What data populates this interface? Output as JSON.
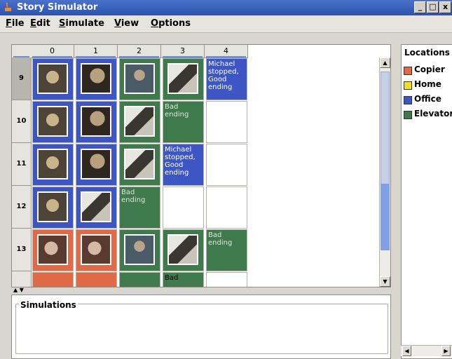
{
  "app": {
    "title": "Story Simulator"
  },
  "window_buttons": {
    "minimize": "_",
    "maximize": "□",
    "close": "x"
  },
  "menu": [
    "File",
    "Edit",
    "Simulate",
    "View",
    "Options"
  ],
  "grid": {
    "columns": [
      "0",
      "1",
      "2",
      "3",
      "4"
    ],
    "rows": [
      {
        "label": "9",
        "cells": [
          {
            "location": "office",
            "image": "face-a"
          },
          {
            "location": "office",
            "image": "face-b"
          },
          {
            "location": "home",
            "image": "guy"
          },
          {
            "location": "home",
            "image": "gun"
          },
          {
            "location": "office",
            "text": "Michael stopped, Good ending"
          }
        ]
      },
      {
        "label": "10",
        "cells": [
          {
            "location": "office",
            "image": "face-a"
          },
          {
            "location": "office",
            "image": "face-b"
          },
          {
            "location": "home",
            "image": "gun"
          },
          {
            "location": "elevator",
            "text": "Bad ending"
          },
          {
            "location": "empty"
          }
        ]
      },
      {
        "label": "11",
        "cells": [
          {
            "location": "office",
            "image": "face-a"
          },
          {
            "location": "office",
            "image": "face-b"
          },
          {
            "location": "home",
            "image": "gun"
          },
          {
            "location": "office",
            "text": "Michael stopped, Good ending"
          },
          {
            "location": "empty"
          }
        ]
      },
      {
        "label": "12",
        "cells": [
          {
            "location": "office",
            "image": "face-a"
          },
          {
            "location": "office",
            "image": "gun"
          },
          {
            "location": "elevator",
            "text": "Bad ending"
          },
          {
            "location": "empty"
          },
          {
            "location": "empty"
          }
        ]
      },
      {
        "label": "13",
        "cells": [
          {
            "location": "copier",
            "image": "woman"
          },
          {
            "location": "copier",
            "image": "woman"
          },
          {
            "location": "home",
            "image": "guy"
          },
          {
            "location": "home",
            "image": "gun"
          },
          {
            "location": "elevator",
            "text": "Bad ending"
          }
        ]
      },
      {
        "label": "",
        "cells": [
          {
            "location": "copier"
          },
          {
            "location": "copier"
          },
          {
            "location": "home"
          },
          {
            "location": "home",
            "text": "Bad"
          },
          {
            "location": "empty"
          }
        ]
      }
    ]
  },
  "simulations": {
    "label": "Simulations"
  },
  "locations": {
    "title": "Locations",
    "items": [
      {
        "label": "Copier",
        "color": "#e06a45"
      },
      {
        "label": "Home",
        "color": "#f2e020"
      },
      {
        "label": "Office",
        "color": "#3e56c4"
      },
      {
        "label": "Elevator",
        "color": "#3f7a4c"
      }
    ]
  },
  "scroll": {
    "up": "▲",
    "down": "▼",
    "left": "◀",
    "right": "▶",
    "split": "▲ ▼"
  }
}
